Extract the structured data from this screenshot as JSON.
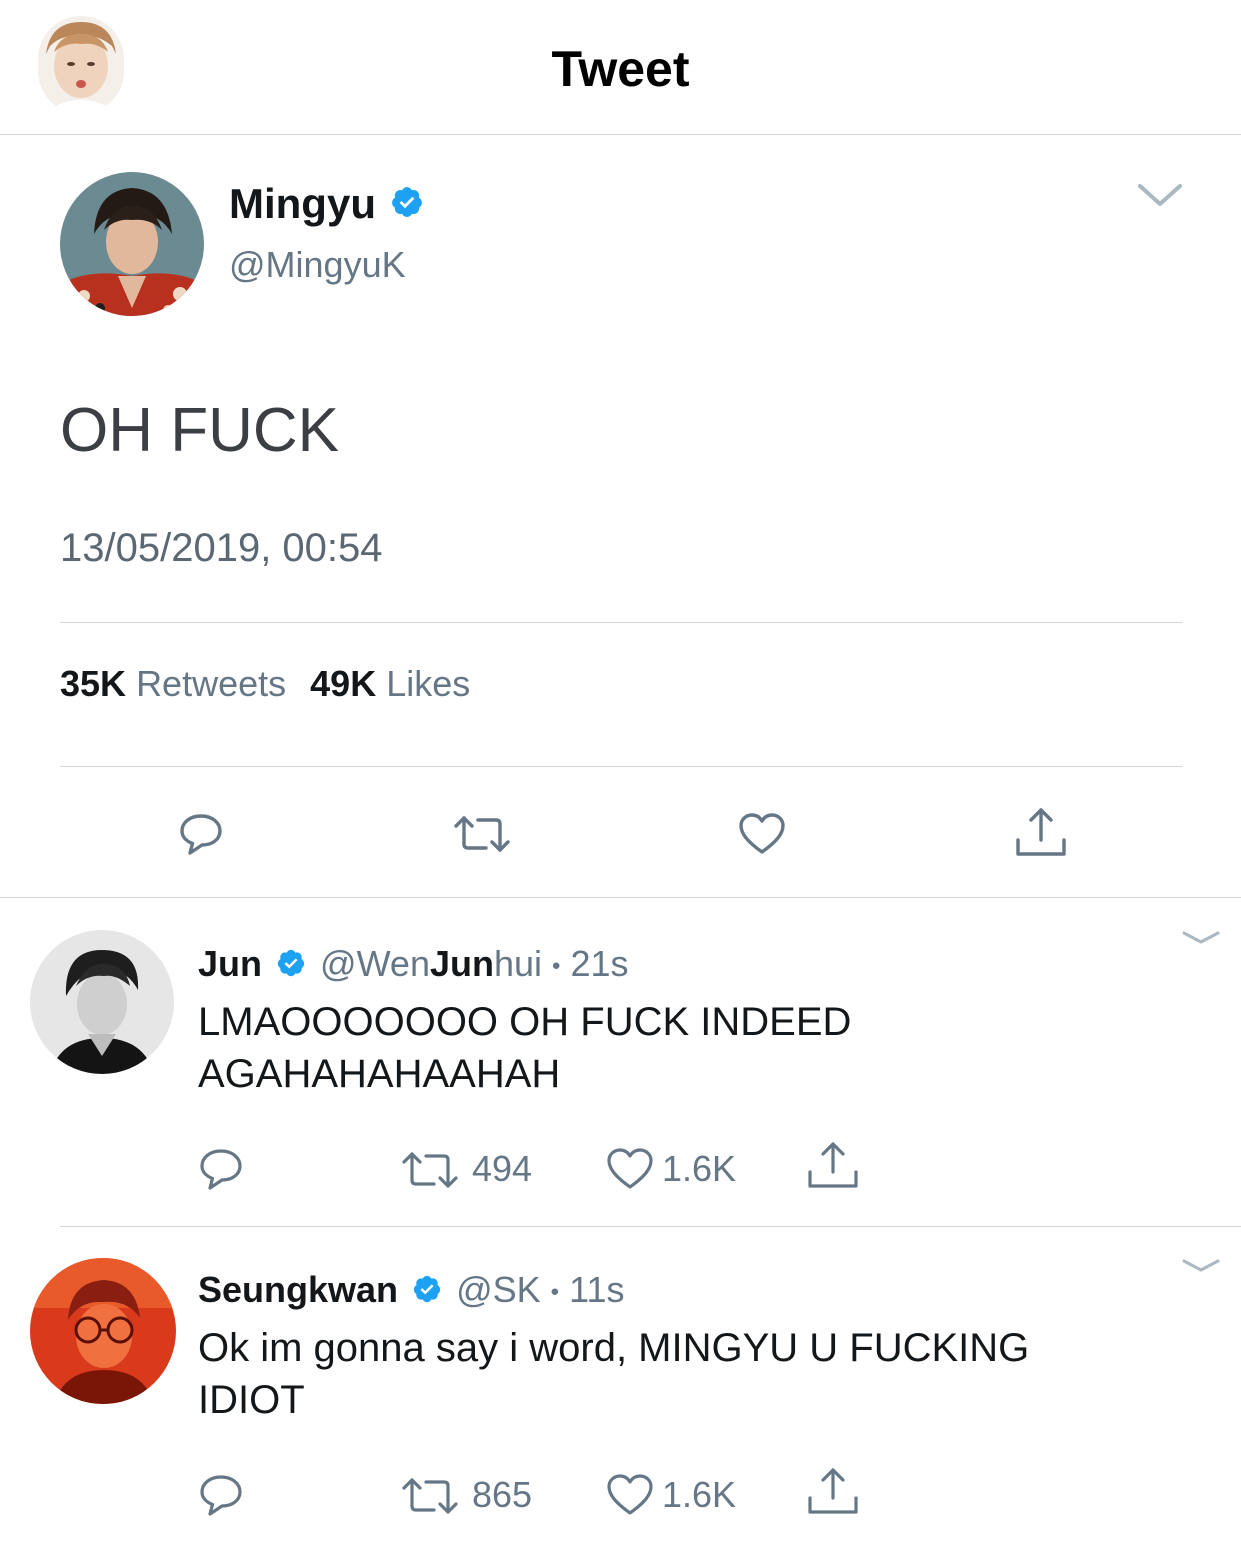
{
  "header": {
    "title": "Tweet"
  },
  "main_tweet": {
    "display_name": "Mingyu",
    "handle": "@MingyuK",
    "text": "OH FUCK",
    "timestamp": "13/05/2019, 00:54",
    "retweets_count": "35K",
    "retweets_label": "Retweets",
    "likes_count": "49K",
    "likes_label": "Likes"
  },
  "replies": [
    {
      "display_name": "Jun",
      "handle_prefix": "@Wen",
      "handle_bold": "Jun",
      "handle_suffix": "hui",
      "separator": "•",
      "time": "21s",
      "text_line1": "LMAOOOOOOO OH FUCK INDEED",
      "text_line2": "AGAHAHAHAAHAH",
      "retweets": "494",
      "likes": "1.6K"
    },
    {
      "display_name": "Seungkwan",
      "handle": "@SK",
      "separator": "•",
      "time": "11s",
      "text_line1": "Ok im gonna say i word, MINGYU U FUCKING",
      "text_line2": "IDIOT",
      "retweets": "865",
      "likes": "1.6K"
    }
  ],
  "colors": {
    "verified_blue": "#1da1f2",
    "secondary_text": "#657786",
    "divider": "#d0d6db",
    "icon_gray": "#657786"
  }
}
